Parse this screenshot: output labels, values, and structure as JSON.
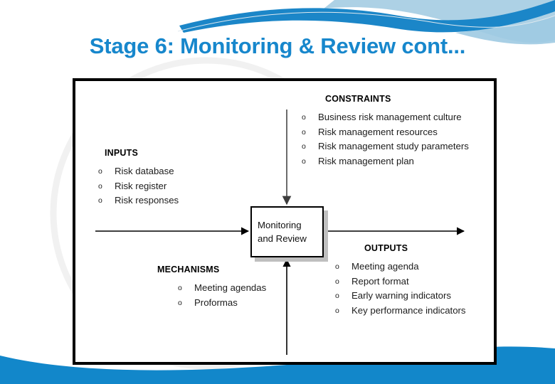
{
  "slide": {
    "title": "Stage 6: Monitoring & Review cont...",
    "title_color": "#1787cc",
    "background_color": "#ffffff"
  },
  "decor": {
    "top_wave_dark_color": "#1b86c8",
    "top_wave_light_color": "#a9cfe4",
    "bottom_wave_color": "#1287ca",
    "faint_arc_color": "#f2f2f2"
  },
  "diagram": {
    "type": "idef0-process-box",
    "border_color": "#000000",
    "process": {
      "line1": "Monitoring",
      "line2": "and Review",
      "shadow_color": "#bfbfbf"
    },
    "arrows": {
      "input_arrow": "left-to-right-into-box",
      "output_arrow": "box-to-right",
      "constraints_arrow": "top-down-into-box",
      "mechanisms_arrow": "bottom-up-into-box",
      "color_black": "#000000",
      "color_gray": "#7f7f7f"
    },
    "sections": [
      {
        "id": "constraints",
        "heading": "CONSTRAINTS",
        "bullet_glyph": "o",
        "items": [
          "Business risk management culture",
          "Risk management resources",
          "Risk management study parameters",
          "Risk management plan"
        ]
      },
      {
        "id": "inputs",
        "heading": "INPUTS",
        "bullet_glyph": "o",
        "items": [
          "Risk database",
          "Risk register",
          "Risk responses"
        ]
      },
      {
        "id": "mechanisms",
        "heading": "MECHANISMS",
        "bullet_glyph": "o",
        "items": [
          "Meeting agendas",
          "Proformas"
        ]
      },
      {
        "id": "outputs",
        "heading": "OUTPUTS",
        "bullet_glyph": "o",
        "items": [
          "Meeting agenda",
          "Report format",
          "Early warning indicators",
          "Key performance indicators"
        ]
      }
    ]
  }
}
